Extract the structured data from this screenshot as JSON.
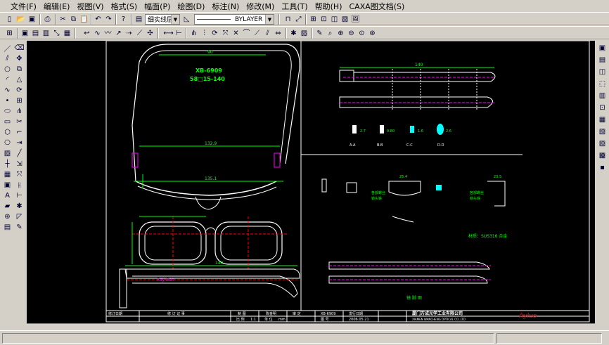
{
  "menu": [
    "文件(F)",
    "编辑(E)",
    "视图(V)",
    "格式(S)",
    "幅面(P)",
    "绘图(D)",
    "标注(N)",
    "修改(M)",
    "工具(T)",
    "帮助(H)",
    "CAXA图文档(S)"
  ],
  "toolbar": {
    "linestyle_combo": "细实线层",
    "color_combo": "BYLAYER"
  },
  "drawing": {
    "model_no": "XB-6909",
    "spec": "58□15-140",
    "dim_top": "90",
    "dim_mid": "132.9",
    "dim_bot": "135.1",
    "temple_len": "140",
    "right_top_dim": "140",
    "sections": [
      "A-A",
      "B-B",
      "C-C",
      "D-D"
    ],
    "section_vals": [
      "0.8",
      "2.7",
      "0.80",
      "1.6",
      "2.6"
    ],
    "detail_dims": [
      "25.4",
      "23.5",
      "3.5",
      "2.7",
      "1.5",
      "1.8",
      "0.5"
    ],
    "detail_labels": [
      "各部螺丝",
      "锁头铁",
      "各部螺丝",
      "锁头铁"
    ],
    "material_note": "材质：SUS316 合金",
    "bottom_label": "镜 脚 图",
    "title_block": {
      "rev_header": "修订日期",
      "rev_content": "修 订 记 事",
      "design": "制 图",
      "check": "审 核",
      "designer": "陈金明",
      "proof": "审 定",
      "model": "XB-6909",
      "scale_label": "比 例",
      "scale": "1:1",
      "unit_label": "单 位",
      "unit": "mm",
      "date_label": "图 号",
      "approve_label": "发行日期",
      "date": "2006.05.21",
      "company_cn": "厦门万成光学工业有限公司",
      "company_en": "XIAMEN WANCHENG OPTICAL CO.,LTD",
      "signature": "Ayluo"
    }
  }
}
